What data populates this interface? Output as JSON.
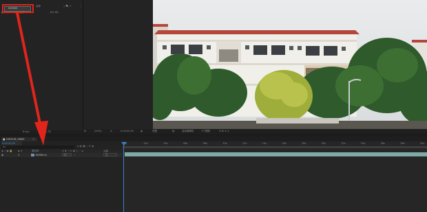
{
  "project": {
    "header_name": "名称",
    "comp_name": "000000",
    "item2_label": "(1)   工作",
    "item2_size": "150 KB",
    "footer_bpc": "8 bpc"
  },
  "viewer": {
    "zoom": "(50%)",
    "timecode": "0;00;00;00",
    "quality": "完整",
    "camera": "活动摄像机",
    "views": "1个视图"
  },
  "timeline": {
    "tab_label": "■ 20HOUR_HWKE",
    "sub_tab": "0;00;00;00",
    "search_placeholder": "ρ▾",
    "col_source_name": "源名称",
    "col_parent": "父级",
    "layer_number": "1",
    "layer_name": "00000.cs",
    "mode": "无",
    "parent": "无",
    "ruler_ticks": [
      "0s",
      "02s",
      "04s",
      "06s",
      "08s",
      "10s",
      "12s",
      "14s",
      "16s",
      "18s",
      "20s",
      "22s",
      "24s",
      "26s",
      "28s",
      "30s"
    ]
  },
  "colors": {
    "annotation_red": "#e0251c",
    "accent_blue": "#3a7fcc",
    "layer_bar": "#7fa9a7"
  }
}
